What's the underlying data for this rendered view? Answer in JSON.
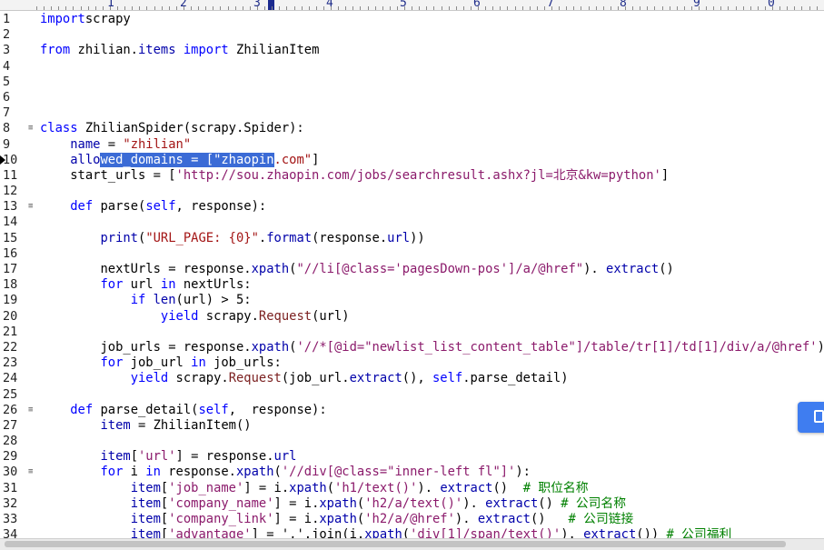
{
  "ruler": {
    "marks": [
      "1",
      "2",
      "3",
      "4",
      "5",
      "6",
      "7",
      "8",
      "9",
      "0"
    ]
  },
  "editor": {
    "lines": [
      {
        "n": "1",
        "segs": [
          [
            "kw",
            "import"
          ],
          [
            "",
            "scrapy"
          ]
        ]
      },
      {
        "n": "2",
        "segs": []
      },
      {
        "n": "3",
        "segs": [
          [
            "kw",
            "from"
          ],
          [
            "",
            " zhilian."
          ],
          [
            "attr",
            "items"
          ],
          [
            "",
            ""
          ],
          [
            "kw",
            " import"
          ],
          [
            "",
            " ZhilianItem"
          ]
        ]
      },
      {
        "n": "4",
        "segs": []
      },
      {
        "n": "5",
        "segs": []
      },
      {
        "n": "6",
        "segs": []
      },
      {
        "n": "7",
        "segs": []
      },
      {
        "n": "8",
        "fold": true,
        "segs": [
          [
            "kw",
            "class"
          ],
          [
            "",
            " ZhilianSpider(scrapy.Spider):"
          ]
        ]
      },
      {
        "n": "9",
        "segs": [
          [
            "",
            "    "
          ],
          [
            "attr",
            "name"
          ],
          [
            "",
            " = "
          ],
          [
            "str",
            "\"zhilian\""
          ]
        ]
      },
      {
        "n": "10",
        "marker": true,
        "segs": [
          [
            "",
            "    "
          ],
          [
            "attr",
            "allo"
          ],
          [
            "sel",
            "wed_domains = [\"zhaopin"
          ],
          [
            "str",
            ".com\""
          ],
          [
            "",
            "]"
          ]
        ]
      },
      {
        "n": "11",
        "segs": [
          [
            "",
            "    start_urls = ["
          ],
          [
            "str2",
            "'http://sou.zhaopin.com/jobs/searchresult.ashx?jl=北京&kw=python'"
          ],
          [
            "",
            "]"
          ]
        ]
      },
      {
        "n": "12",
        "segs": []
      },
      {
        "n": "13",
        "fold": true,
        "segs": [
          [
            "",
            "    "
          ],
          [
            "kw",
            "def"
          ],
          [
            "",
            " parse("
          ],
          [
            "kw",
            "self"
          ],
          [
            "",
            ", response):"
          ]
        ]
      },
      {
        "n": "14",
        "segs": []
      },
      {
        "n": "15",
        "segs": [
          [
            "",
            "        "
          ],
          [
            "attr",
            "print"
          ],
          [
            "",
            "("
          ],
          [
            "str",
            "\"URL_PAGE: {0}\""
          ],
          [
            "",
            "."
          ],
          [
            "attr",
            "format"
          ],
          [
            "",
            "(response."
          ],
          [
            "attr",
            "url"
          ],
          [
            "",
            "))"
          ]
        ]
      },
      {
        "n": "16",
        "segs": []
      },
      {
        "n": "17",
        "segs": [
          [
            "",
            "        nextUrls = response."
          ],
          [
            "attr",
            "xpath"
          ],
          [
            "",
            "("
          ],
          [
            "str2",
            "\"//li[@class='pagesDown-pos']/a/@href\""
          ],
          [
            "",
            "). "
          ],
          [
            "attr",
            "extract"
          ],
          [
            "",
            "()"
          ]
        ]
      },
      {
        "n": "18",
        "segs": [
          [
            "",
            "        "
          ],
          [
            "kw",
            "for"
          ],
          [
            "",
            " url "
          ],
          [
            "kw",
            "in"
          ],
          [
            "",
            " nextUrls:"
          ]
        ]
      },
      {
        "n": "19",
        "segs": [
          [
            "",
            "            "
          ],
          [
            "kw",
            "if"
          ],
          [
            "",
            " "
          ],
          [
            "attr",
            "len"
          ],
          [
            "",
            "(url) > 5:"
          ]
        ]
      },
      {
        "n": "20",
        "segs": [
          [
            "",
            "                "
          ],
          [
            "kw",
            "yield"
          ],
          [
            "",
            " scrapy."
          ],
          [
            "fn",
            "Request"
          ],
          [
            "",
            "(url)"
          ]
        ]
      },
      {
        "n": "21",
        "segs": []
      },
      {
        "n": "22",
        "segs": [
          [
            "",
            "        job_urls = response."
          ],
          [
            "attr",
            "xpath"
          ],
          [
            "",
            "("
          ],
          [
            "str2",
            "'//*[@id=\"newlist_list_content_table\"]/table/tr[1]/td[1]/div/a/@href'"
          ],
          [
            "",
            ")"
          ]
        ]
      },
      {
        "n": "23",
        "segs": [
          [
            "",
            "        "
          ],
          [
            "kw",
            "for"
          ],
          [
            "",
            " job_url "
          ],
          [
            "kw",
            "in"
          ],
          [
            "",
            " job_urls:"
          ]
        ]
      },
      {
        "n": "24",
        "segs": [
          [
            "",
            "            "
          ],
          [
            "kw",
            "yield"
          ],
          [
            "",
            " scrapy."
          ],
          [
            "fn",
            "Request"
          ],
          [
            "",
            "(job_url."
          ],
          [
            "attr",
            "extract"
          ],
          [
            "",
            "(), "
          ],
          [
            "kw",
            "self"
          ],
          [
            "",
            ".parse_detail)"
          ]
        ]
      },
      {
        "n": "25",
        "segs": []
      },
      {
        "n": "26",
        "fold": true,
        "segs": [
          [
            "",
            "    "
          ],
          [
            "kw",
            "def"
          ],
          [
            "",
            " parse_detail("
          ],
          [
            "kw",
            "self"
          ],
          [
            "",
            ",  response):"
          ]
        ]
      },
      {
        "n": "27",
        "segs": [
          [
            "",
            "        "
          ],
          [
            "attr",
            "item"
          ],
          [
            "",
            " = ZhilianItem()"
          ]
        ]
      },
      {
        "n": "28",
        "segs": []
      },
      {
        "n": "29",
        "segs": [
          [
            "",
            "        "
          ],
          [
            "attr",
            "item"
          ],
          [
            "",
            "["
          ],
          [
            "str2",
            "'url'"
          ],
          [
            "",
            "] = response."
          ],
          [
            "attr",
            "url"
          ]
        ]
      },
      {
        "n": "30",
        "fold": true,
        "segs": [
          [
            "",
            "        "
          ],
          [
            "kw",
            "for"
          ],
          [
            "",
            " i "
          ],
          [
            "kw",
            "in"
          ],
          [
            "",
            " response."
          ],
          [
            "attr",
            "xpath"
          ],
          [
            "",
            "("
          ],
          [
            "str2",
            "'//div[@class=\"inner-left fl\"]'"
          ],
          [
            "",
            "):"
          ]
        ]
      },
      {
        "n": "31",
        "segs": [
          [
            "",
            "            "
          ],
          [
            "attr",
            "item"
          ],
          [
            "",
            "["
          ],
          [
            "str2",
            "'job_name'"
          ],
          [
            "",
            "] = i."
          ],
          [
            "attr",
            "xpath"
          ],
          [
            "",
            "("
          ],
          [
            "str2",
            "'h1/text()'"
          ],
          [
            "",
            "). "
          ],
          [
            "attr",
            "extract"
          ],
          [
            "",
            "()  "
          ],
          [
            "cm",
            "# 职位名称"
          ]
        ]
      },
      {
        "n": "32",
        "segs": [
          [
            "",
            "            "
          ],
          [
            "attr",
            "item"
          ],
          [
            "",
            "["
          ],
          [
            "str2",
            "'company_name'"
          ],
          [
            "",
            "] = i."
          ],
          [
            "attr",
            "xpath"
          ],
          [
            "",
            "("
          ],
          [
            "str2",
            "'h2/a/text()'"
          ],
          [
            "",
            "). "
          ],
          [
            "attr",
            "extract"
          ],
          [
            "",
            "() "
          ],
          [
            "cm",
            "# 公司名称"
          ]
        ]
      },
      {
        "n": "33",
        "segs": [
          [
            "",
            "            "
          ],
          [
            "attr",
            "item"
          ],
          [
            "",
            "["
          ],
          [
            "str2",
            "'company_link'"
          ],
          [
            "",
            "] = i."
          ],
          [
            "attr",
            "xpath"
          ],
          [
            "",
            "("
          ],
          [
            "str2",
            "'h2/a/@href'"
          ],
          [
            "",
            "). "
          ],
          [
            "attr",
            "extract"
          ],
          [
            "",
            "()   "
          ],
          [
            "cm",
            "# 公司链接"
          ]
        ]
      },
      {
        "n": "34",
        "segs": [
          [
            "",
            "            "
          ],
          [
            "attr",
            "item"
          ],
          [
            "",
            "["
          ],
          [
            "str2",
            "'advantage'"
          ],
          [
            "",
            "] = ','.join(i."
          ],
          [
            "attr",
            "xpath"
          ],
          [
            "",
            "("
          ],
          [
            "str2",
            "'div[1]/span/text()'"
          ],
          [
            "",
            "). "
          ],
          [
            "attr",
            "extract"
          ],
          [
            "",
            "()) "
          ],
          [
            "cm",
            "# 公司福利"
          ]
        ]
      }
    ]
  },
  "colors": {
    "keyword": "#0000ff",
    "selection": "#3b6bd6",
    "accent": "#3f7df0"
  },
  "float_button": {
    "icon": "document-icon"
  }
}
